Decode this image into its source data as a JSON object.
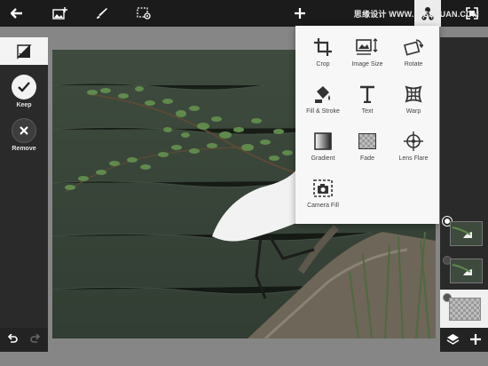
{
  "app": {
    "watermark": "思缘设计 WWW.MISSYUAN.COM"
  },
  "colors": {
    "toolbar": "#1b1b1b",
    "panel": "#2a2a2a",
    "canvas_bg": "#868686",
    "popover": "#f7f7f7"
  },
  "toolbar": {
    "icons": [
      "back-arrow-icon",
      "add-image-icon",
      "brush-icon",
      "selection-settings-icon",
      "plus-icon",
      "effects-tool-icon",
      "fullscreen-icon"
    ]
  },
  "left_panel": {
    "keep_label": "Keep",
    "remove_label": "Remove"
  },
  "tools_menu": {
    "items": [
      {
        "label": "Crop",
        "icon": "crop-icon"
      },
      {
        "label": "Image Size",
        "icon": "image-size-icon"
      },
      {
        "label": "Rotate",
        "icon": "rotate-icon"
      },
      {
        "label": "Fill & Stroke",
        "icon": "fill-stroke-icon"
      },
      {
        "label": "Text",
        "icon": "text-icon"
      },
      {
        "label": "Warp",
        "icon": "warp-icon"
      },
      {
        "label": "Gradient",
        "icon": "gradient-icon"
      },
      {
        "label": "Fade",
        "icon": "fade-icon"
      },
      {
        "label": "Lens Flare",
        "icon": "lens-flare-icon"
      },
      {
        "label": "Camera Fill",
        "icon": "camera-fill-icon"
      }
    ]
  },
  "layers": {
    "count": 3,
    "selected_index": 2
  }
}
